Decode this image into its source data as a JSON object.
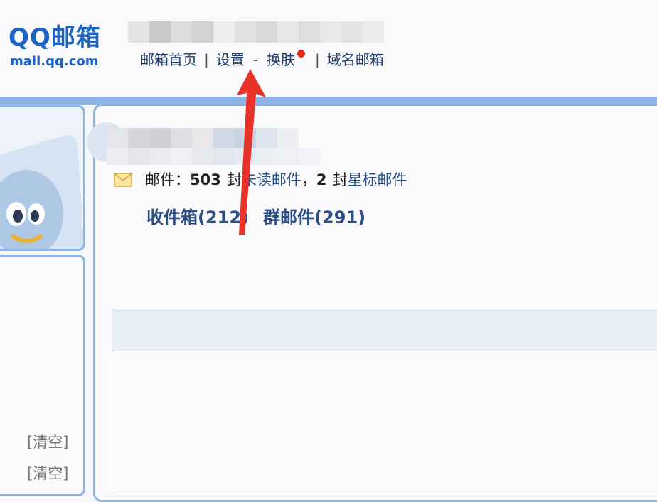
{
  "logo": {
    "title": "QQ邮箱",
    "url": "mail.qq.com"
  },
  "topnav": {
    "home": "邮箱首页",
    "sep1": "|",
    "settings": "设置",
    "dash": "-",
    "skin": "换肤",
    "sep2": "|",
    "domain_mail": "域名邮箱"
  },
  "summary": {
    "prefix": "邮件：",
    "total": "503",
    "unit1": "封",
    "unread_label": "未读邮件",
    "comma": "，",
    "starred_count": "2",
    "unit2": "封",
    "starred_label": "星标邮件"
  },
  "folders": {
    "inbox": "收件箱(212)",
    "group": "群邮件(291)"
  },
  "sidebar": {
    "clear1": "[清空]",
    "clear2": "[清空]"
  },
  "colors": {
    "accent_blue": "#1c64c2",
    "frame_blue": "#8eb4e3",
    "arrow_red": "#e8332a"
  },
  "icons": [
    "envelope-icon",
    "notification-dot",
    "qq-penguin-illustration",
    "red-arrow-annotation"
  ]
}
